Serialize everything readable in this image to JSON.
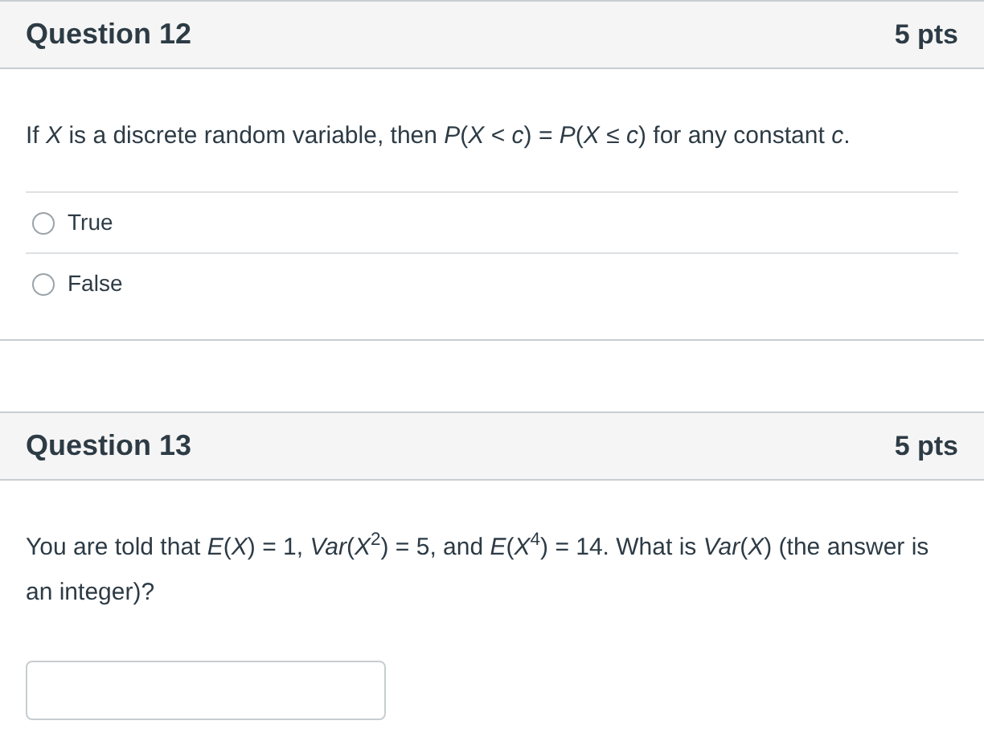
{
  "questions": [
    {
      "title": "Question 12",
      "points": "5 pts",
      "kind": "choice",
      "prompt": "If *X* is a discrete random variable, then *P*(*X* < *c*) = *P*(*X* ≤ *c*) for any constant *c*.",
      "options": [
        {
          "label": "True",
          "selected": false
        },
        {
          "label": "False",
          "selected": false
        }
      ]
    },
    {
      "title": "Question 13",
      "points": "5 pts",
      "kind": "numeric",
      "prompt": "You are told that *E*(*X*) = 1, *Var*(*X*$^{2}$) = 5, and *E*(*X*$^{4}$) = 14. What is *Var*(*X*) (the answer is an integer)?"
    }
  ]
}
